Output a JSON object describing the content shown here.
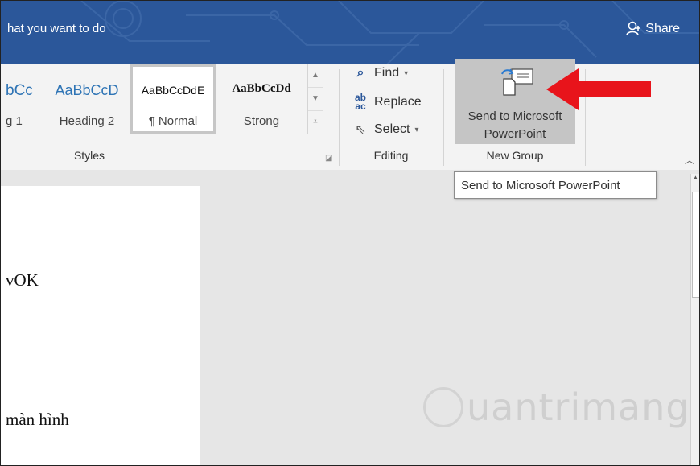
{
  "titlebar": {
    "tell_me_text": "hat you want to do",
    "share_label": "Share"
  },
  "styles_gallery": {
    "items": [
      {
        "sample": "bCc",
        "name": "g 1"
      },
      {
        "sample": "AaBbCcD",
        "name": "Heading 2"
      },
      {
        "sample": "AaBbCcDdE",
        "name": "¶ Normal"
      },
      {
        "sample": "AaBbCcDd",
        "name": "Strong"
      }
    ],
    "group_label": "Styles"
  },
  "editing": {
    "find_label": "Find",
    "replace_label": "Replace",
    "select_label": "Select",
    "group_label": "Editing"
  },
  "new_group": {
    "button_line1": "Send to Microsoft",
    "button_line2": "PowerPoint",
    "group_label": "New Group"
  },
  "tooltip": {
    "text": "Send to Microsoft PowerPoint"
  },
  "document": {
    "line1": "vOK",
    "line2": "màn hình"
  },
  "watermark": {
    "text": "uantrimang"
  },
  "colors": {
    "title_bar": "#2b579a",
    "highlight_button": "#c5c5c5",
    "red_arrow": "#e8141b"
  }
}
